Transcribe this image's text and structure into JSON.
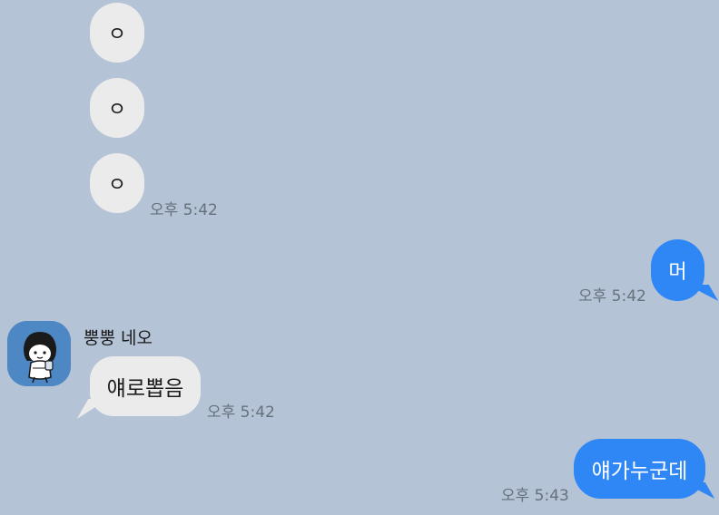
{
  "chat": {
    "messages": [
      {
        "from": "them",
        "text": "ㅇ"
      },
      {
        "from": "them",
        "text": "ㅇ"
      },
      {
        "from": "them",
        "text": "ㅇ",
        "time": "오후 5:42"
      },
      {
        "from": "me",
        "text": "머",
        "time": "오후 5:42"
      },
      {
        "from": "them",
        "sender": "뿡뿡 네오",
        "text": "얘로뽑음",
        "time": "오후 5:42"
      },
      {
        "from": "me",
        "text": "얘가누군데",
        "time": "오후 5:43"
      }
    ]
  },
  "colors": {
    "background": "#b4c3d6",
    "incoming_bubble": "#ebebeb",
    "outgoing_bubble": "#2f86f5",
    "timestamp": "#67717c",
    "avatar_bg": "#4d88c4"
  },
  "icons": {
    "avatar": "neo-character-avatar-icon"
  }
}
